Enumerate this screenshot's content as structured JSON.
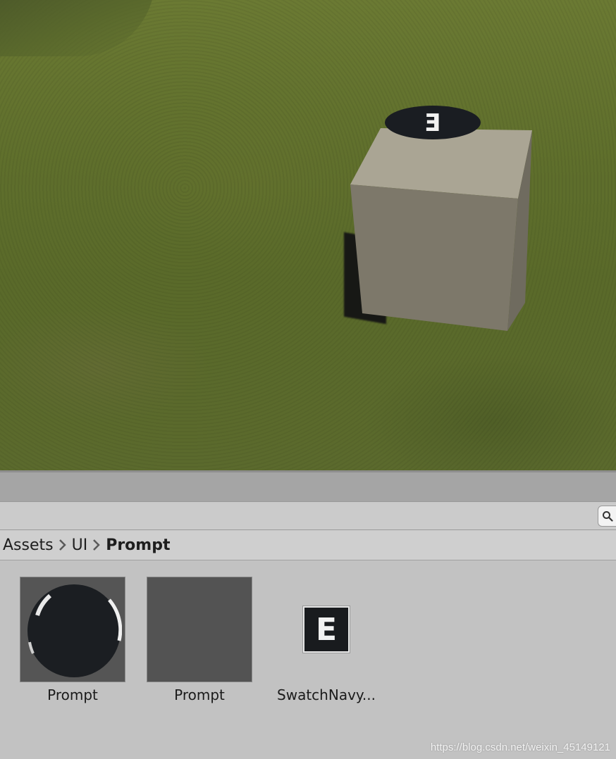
{
  "breadcrumb": {
    "items": [
      "Assets",
      "UI",
      "Prompt"
    ]
  },
  "assets": [
    {
      "name": "Prompt",
      "kind": "material"
    },
    {
      "name": "Prompt",
      "kind": "prefab"
    },
    {
      "name": "SwatchNavy...",
      "kind": "texture",
      "glyph": "E"
    }
  ],
  "scene": {
    "prompt_glyph": "E",
    "colors": {
      "grass": "#5f6f2c",
      "cube_top": "#aaa594",
      "cube_front": "#7f7a6c",
      "prompt_disc": "#1a1d22"
    }
  },
  "watermark": "https://blog.csdn.net/weixin_45149121"
}
